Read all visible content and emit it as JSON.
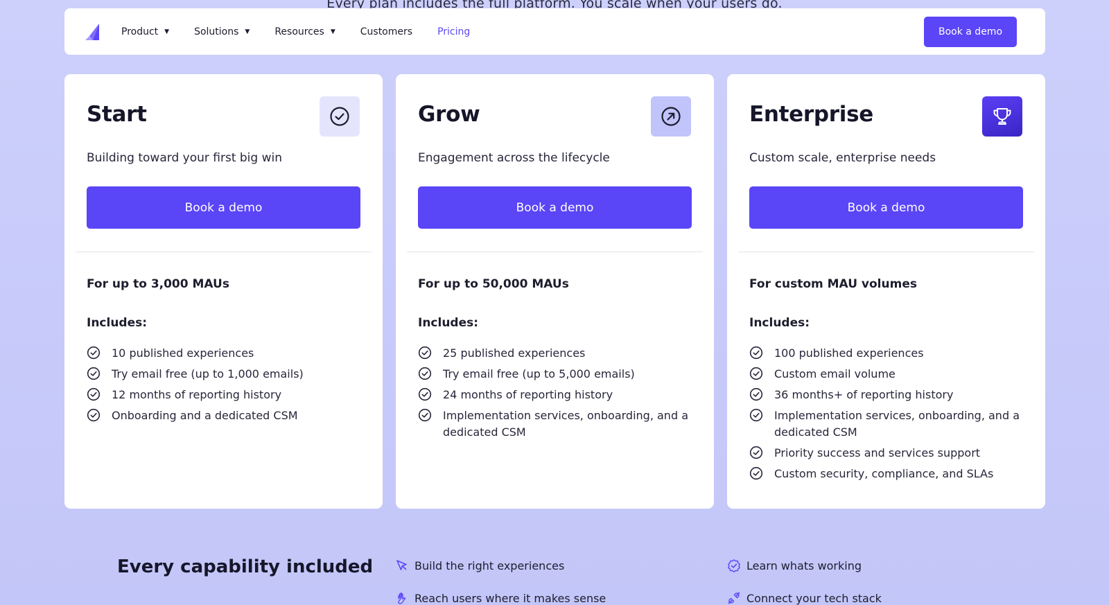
{
  "behind_text": "Every plan includes the full platform. You scale when your users do.",
  "nav": {
    "items": [
      {
        "label": "Product",
        "has_caret": true
      },
      {
        "label": "Solutions",
        "has_caret": true
      },
      {
        "label": "Resources",
        "has_caret": true
      },
      {
        "label": "Customers",
        "has_caret": false
      },
      {
        "label": "Pricing",
        "has_caret": false,
        "active": true
      }
    ],
    "cta": "Book a demo"
  },
  "plans": [
    {
      "name": "Start",
      "icon": "check-circle-icon",
      "subtitle": "Building toward your first big win",
      "cta": "Book a demo",
      "mau": "For up to 3,000 MAUs",
      "includes_label": "Includes:",
      "features": [
        "10 published experiences",
        "Try email free (up to 1,000 emails)",
        "12 months of reporting history",
        "Onboarding and a dedicated CSM"
      ]
    },
    {
      "name": "Grow",
      "icon": "arrow-up-right-circle-icon",
      "subtitle": "Engagement across the lifecycle",
      "cta": "Book a demo",
      "mau": "For up to 50,000 MAUs",
      "includes_label": "Includes:",
      "features": [
        "25 published experiences",
        "Try email free (up to 5,000 emails)",
        "24 months of reporting history",
        "Implementation services, onboarding, and a dedicated CSM"
      ]
    },
    {
      "name": "Enterprise",
      "icon": "trophy-icon",
      "subtitle": "Custom scale, enterprise needs",
      "cta": "Book a demo",
      "mau": "For custom MAU volumes",
      "includes_label": "Includes:",
      "features": [
        "100 published experiences",
        "Custom email volume",
        "36 months+ of reporting history",
        "Implementation services, onboarding, and a dedicated CSM",
        "Priority success and services support",
        "Custom security, compliance, and SLAs"
      ]
    }
  ],
  "capabilities": {
    "title": "Every capability included",
    "items": [
      {
        "label": "Build the right experiences",
        "icon": "cursor-click-icon"
      },
      {
        "label": "Learn whats working",
        "icon": "badge-check-icon"
      },
      {
        "label": "Reach users where it makes sense",
        "icon": "hand-wave-icon"
      },
      {
        "label": "Connect your tech stack",
        "icon": "plug-icon"
      }
    ]
  },
  "colors": {
    "accent": "#5a45f7",
    "background": "#c8cbfa",
    "text": "#16162a"
  }
}
